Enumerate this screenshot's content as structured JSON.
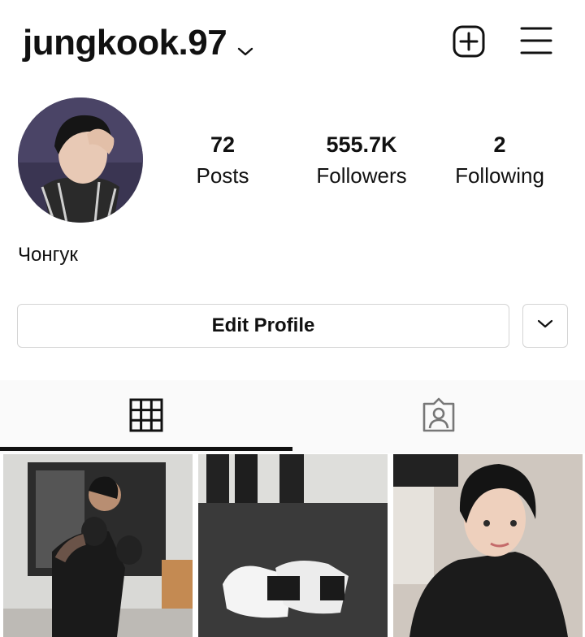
{
  "header": {
    "username": "jungkook.97",
    "icons": [
      "chevron-down-icon",
      "new-post-icon",
      "menu-icon"
    ]
  },
  "stats": {
    "posts": {
      "value": "72",
      "label": "Posts"
    },
    "followers": {
      "value": "555.7K",
      "label": "Followers"
    },
    "following": {
      "value": "2",
      "label": "Following"
    }
  },
  "profile": {
    "display_name": "Чонгук",
    "edit_button": "Edit Profile"
  },
  "tabs": [
    "grid-icon",
    "tagged-icon"
  ],
  "colors": {
    "text": "#111111",
    "border": "#d4d4d4",
    "tab_bg": "#fafafa"
  }
}
